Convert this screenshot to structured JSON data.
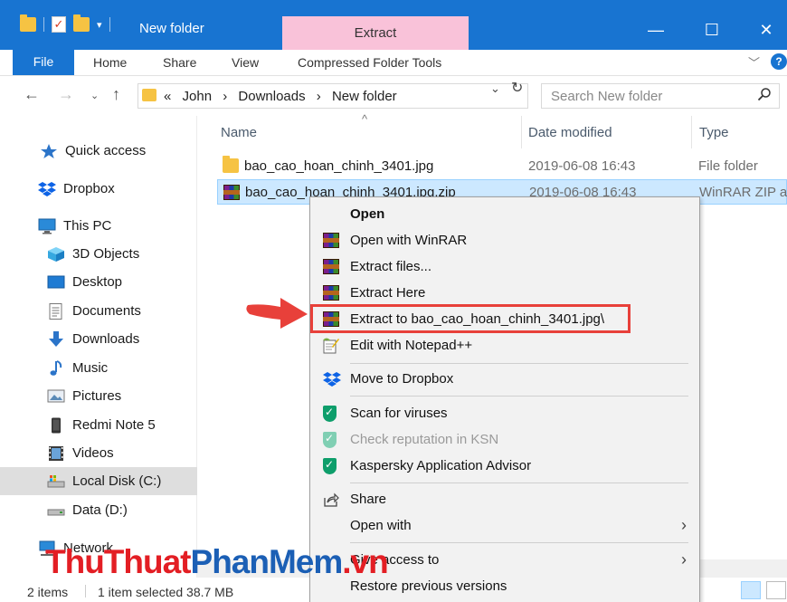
{
  "window": {
    "title": "New folder",
    "context_tab": "Extract",
    "controls": {
      "minimize": "—",
      "maximize": "☐",
      "close": "✕"
    }
  },
  "ribbon": {
    "tabs": [
      "File",
      "Home",
      "Share",
      "View",
      "Compressed Folder Tools"
    ],
    "help": "?"
  },
  "address": {
    "prefix": "«",
    "crumbs": [
      "John",
      "Downloads",
      "New folder"
    ],
    "separator": "›"
  },
  "search": {
    "placeholder": "Search New folder"
  },
  "sidebar": {
    "items": [
      {
        "label": "Quick access",
        "icon": "star-icon"
      },
      {
        "label": "Dropbox",
        "icon": "dropbox-icon"
      },
      {
        "label": "This PC",
        "icon": "monitor-icon"
      },
      {
        "label": "3D Objects",
        "icon": "cube-icon"
      },
      {
        "label": "Desktop",
        "icon": "desktop-icon"
      },
      {
        "label": "Documents",
        "icon": "document-icon"
      },
      {
        "label": "Downloads",
        "icon": "download-arrow-icon"
      },
      {
        "label": "Music",
        "icon": "music-note-icon"
      },
      {
        "label": "Pictures",
        "icon": "picture-icon"
      },
      {
        "label": "Redmi Note 5",
        "icon": "phone-icon"
      },
      {
        "label": "Videos",
        "icon": "film-icon"
      },
      {
        "label": "Local Disk (C:)",
        "icon": "drive-icon"
      },
      {
        "label": "Data (D:)",
        "icon": "drive-icon"
      },
      {
        "label": "Network",
        "icon": "network-icon"
      }
    ]
  },
  "columns": {
    "name": "Name",
    "date": "Date modified",
    "type": "Type"
  },
  "files": [
    {
      "name": "bao_cao_hoan_chinh_3401.jpg",
      "date": "2019-06-08 16:43",
      "type": "File folder",
      "icon": "folder-icon"
    },
    {
      "name": "bao_cao_hoan_chinh_3401.jpg.zip",
      "date": "2019-06-08 16:43",
      "type": "WinRAR ZIP ar",
      "icon": "winrar-icon"
    }
  ],
  "context_menu": {
    "items": [
      {
        "label": "Open",
        "icon": ""
      },
      {
        "label": "Open with WinRAR",
        "icon": "winrar-icon"
      },
      {
        "label": "Extract files...",
        "icon": "winrar-icon"
      },
      {
        "label": "Extract Here",
        "icon": "winrar-icon"
      },
      {
        "label": "Extract to bao_cao_hoan_chinh_3401.jpg\\",
        "icon": "winrar-icon"
      },
      {
        "label": "Edit with Notepad++",
        "icon": "notepad-icon"
      },
      {
        "label": "Move to Dropbox",
        "icon": "dropbox-icon"
      },
      {
        "label": "Scan for viruses",
        "icon": "kaspersky-icon"
      },
      {
        "label": "Check reputation in KSN",
        "icon": "kaspersky-icon"
      },
      {
        "label": "Kaspersky Application Advisor",
        "icon": "kaspersky-icon"
      },
      {
        "label": "Share",
        "icon": "share-icon"
      },
      {
        "label": "Open with",
        "icon": ""
      },
      {
        "label": "Give access to",
        "icon": ""
      },
      {
        "label": "Restore previous versions",
        "icon": ""
      }
    ]
  },
  "status": {
    "items": "2 items",
    "selected": "1 item selected  38.7 MB"
  },
  "watermark": {
    "part1": "ThuThuat",
    "part2": "PhanMem",
    "part3": ".vn"
  },
  "colors": {
    "titlebar": "#1874d1",
    "extract_tab": "#f9c2d9",
    "highlight": "#e8403a",
    "selection": "#cce8ff"
  }
}
